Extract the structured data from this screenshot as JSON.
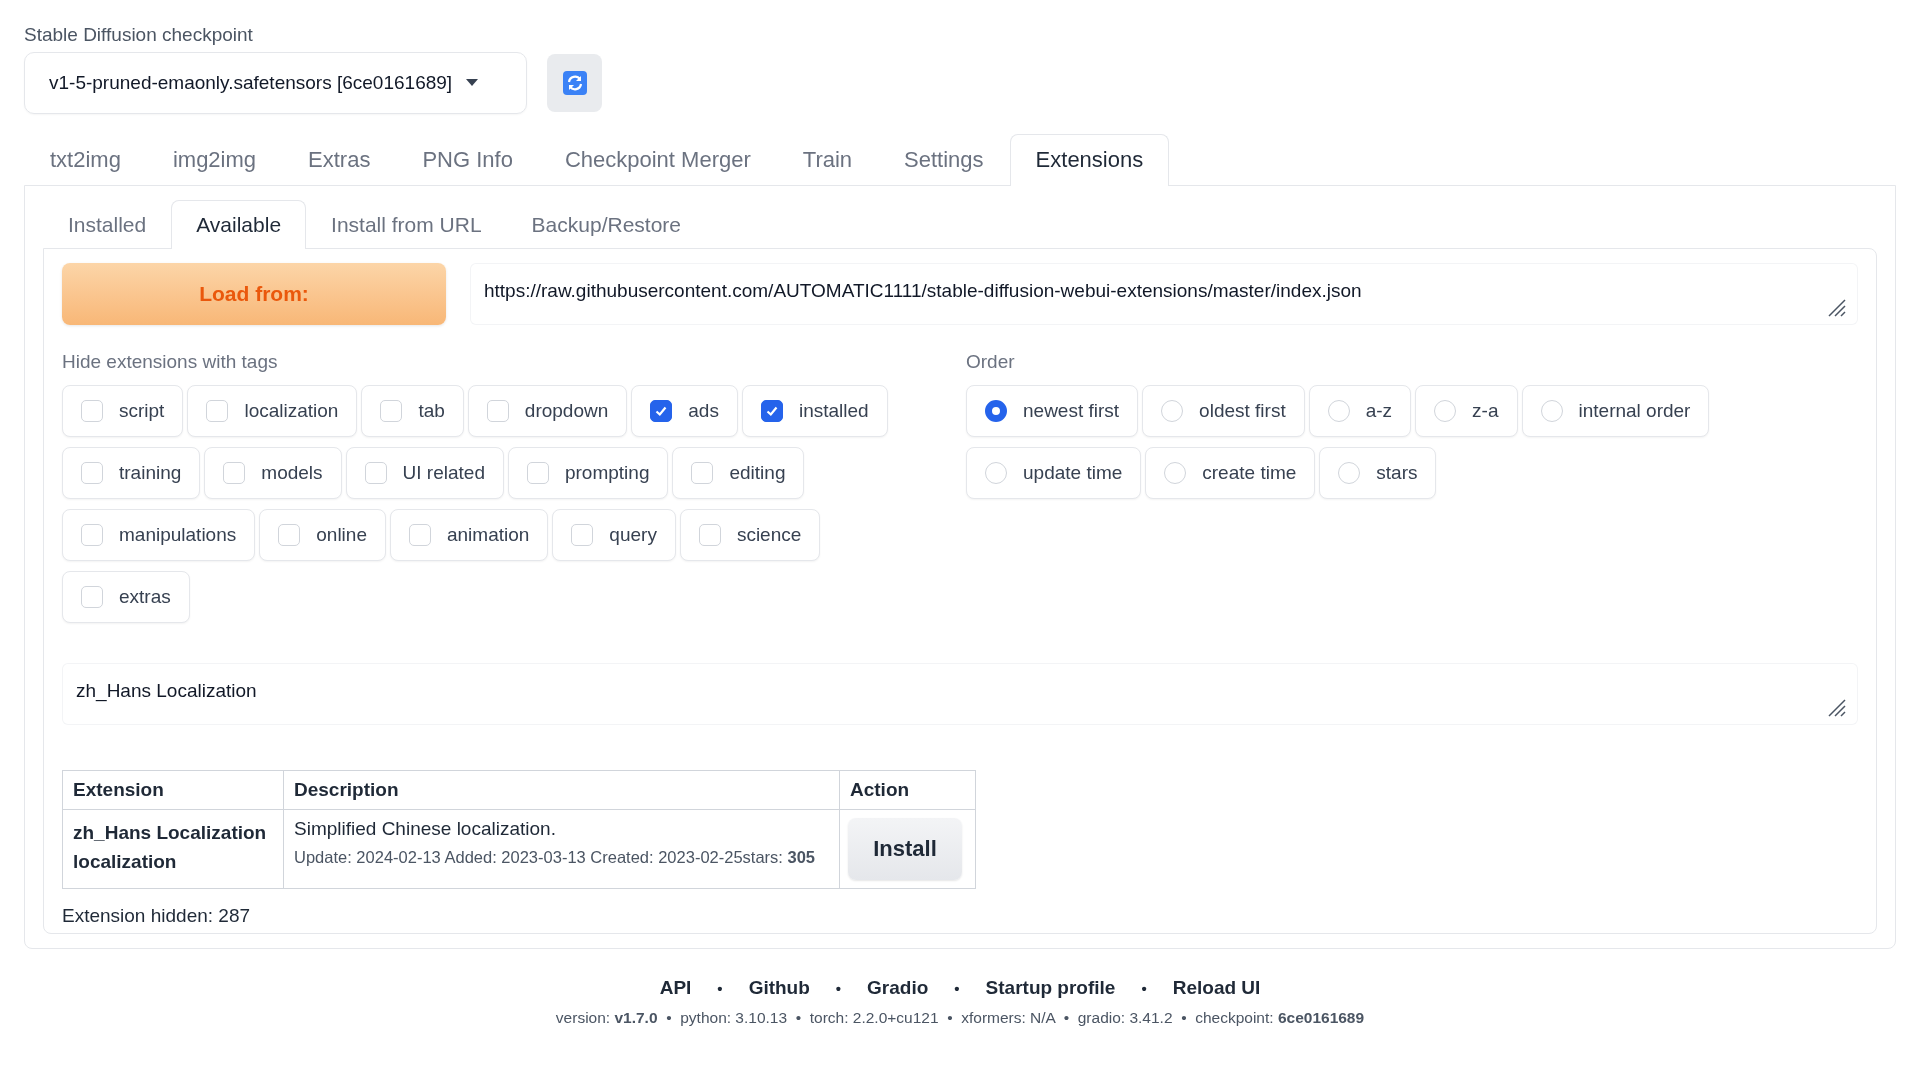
{
  "checkpoint": {
    "label": "Stable Diffusion checkpoint",
    "value": "v1-5-pruned-emaonly.safetensors [6ce0161689]"
  },
  "tabs": [
    {
      "label": "txt2img",
      "selected": false
    },
    {
      "label": "img2img",
      "selected": false
    },
    {
      "label": "Extras",
      "selected": false
    },
    {
      "label": "PNG Info",
      "selected": false
    },
    {
      "label": "Checkpoint Merger",
      "selected": false
    },
    {
      "label": "Train",
      "selected": false
    },
    {
      "label": "Settings",
      "selected": false
    },
    {
      "label": "Extensions",
      "selected": true
    }
  ],
  "subtabs": [
    {
      "label": "Installed",
      "selected": false
    },
    {
      "label": "Available",
      "selected": true
    },
    {
      "label": "Install from URL",
      "selected": false
    },
    {
      "label": "Backup/Restore",
      "selected": false
    }
  ],
  "load_button": "Load from:",
  "url_field": {
    "value": "https://raw.githubusercontent.com/AUTOMATIC1111/stable-diffusion-webui-extensions/master/index.json"
  },
  "hide_tags": {
    "label": "Hide extensions with tags",
    "tags": [
      {
        "label": "script",
        "checked": false
      },
      {
        "label": "localization",
        "checked": false
      },
      {
        "label": "tab",
        "checked": false
      },
      {
        "label": "dropdown",
        "checked": false
      },
      {
        "label": "ads",
        "checked": true
      },
      {
        "label": "installed",
        "checked": true
      },
      {
        "label": "training",
        "checked": false
      },
      {
        "label": "models",
        "checked": false
      },
      {
        "label": "UI related",
        "checked": false
      },
      {
        "label": "prompting",
        "checked": false
      },
      {
        "label": "editing",
        "checked": false
      },
      {
        "label": "manipulations",
        "checked": false
      },
      {
        "label": "online",
        "checked": false
      },
      {
        "label": "animation",
        "checked": false
      },
      {
        "label": "query",
        "checked": false
      },
      {
        "label": "science",
        "checked": false
      },
      {
        "label": "extras",
        "checked": false
      }
    ]
  },
  "order": {
    "label": "Order",
    "options": [
      {
        "label": "newest first",
        "selected": true
      },
      {
        "label": "oldest first",
        "selected": false
      },
      {
        "label": "a-z",
        "selected": false
      },
      {
        "label": "z-a",
        "selected": false
      },
      {
        "label": "internal order",
        "selected": false
      },
      {
        "label": "update time",
        "selected": false
      },
      {
        "label": "create time",
        "selected": false
      },
      {
        "label": "stars",
        "selected": false
      }
    ]
  },
  "search_field": {
    "value": "zh_Hans Localization"
  },
  "table": {
    "columns": [
      "Extension",
      "Description",
      "Action"
    ],
    "rows": [
      {
        "name": "zh_Hans Localization",
        "tags": "localization",
        "description": "Simplified Chinese localization.",
        "details": "Update: 2024-02-13 Added: 2023-03-13 Created: 2023-02-25stars: **305**",
        "action": "Install"
      }
    ]
  },
  "hidden_count": "Extension hidden: 287",
  "footer": {
    "links": [
      {
        "kind": "link",
        "text": "API"
      },
      {
        "kind": "separator",
        "text": "•"
      },
      {
        "kind": "link",
        "text": "Github"
      },
      {
        "kind": "separator",
        "text": "•"
      },
      {
        "kind": "link",
        "text": "Gradio"
      },
      {
        "kind": "separator",
        "text": "•"
      },
      {
        "kind": "link",
        "text": "Startup profile"
      },
      {
        "kind": "separator",
        "text": "•"
      },
      {
        "kind": "link",
        "text": "Reload UI"
      }
    ],
    "versions": "version: **v1.7.0**  •  python: 3.10.13  •  torch: 2.2.0+cu121  •  xformers: N/A  •  gradio: 3.41.2  •  checkpoint: **6ce0161689**"
  }
}
